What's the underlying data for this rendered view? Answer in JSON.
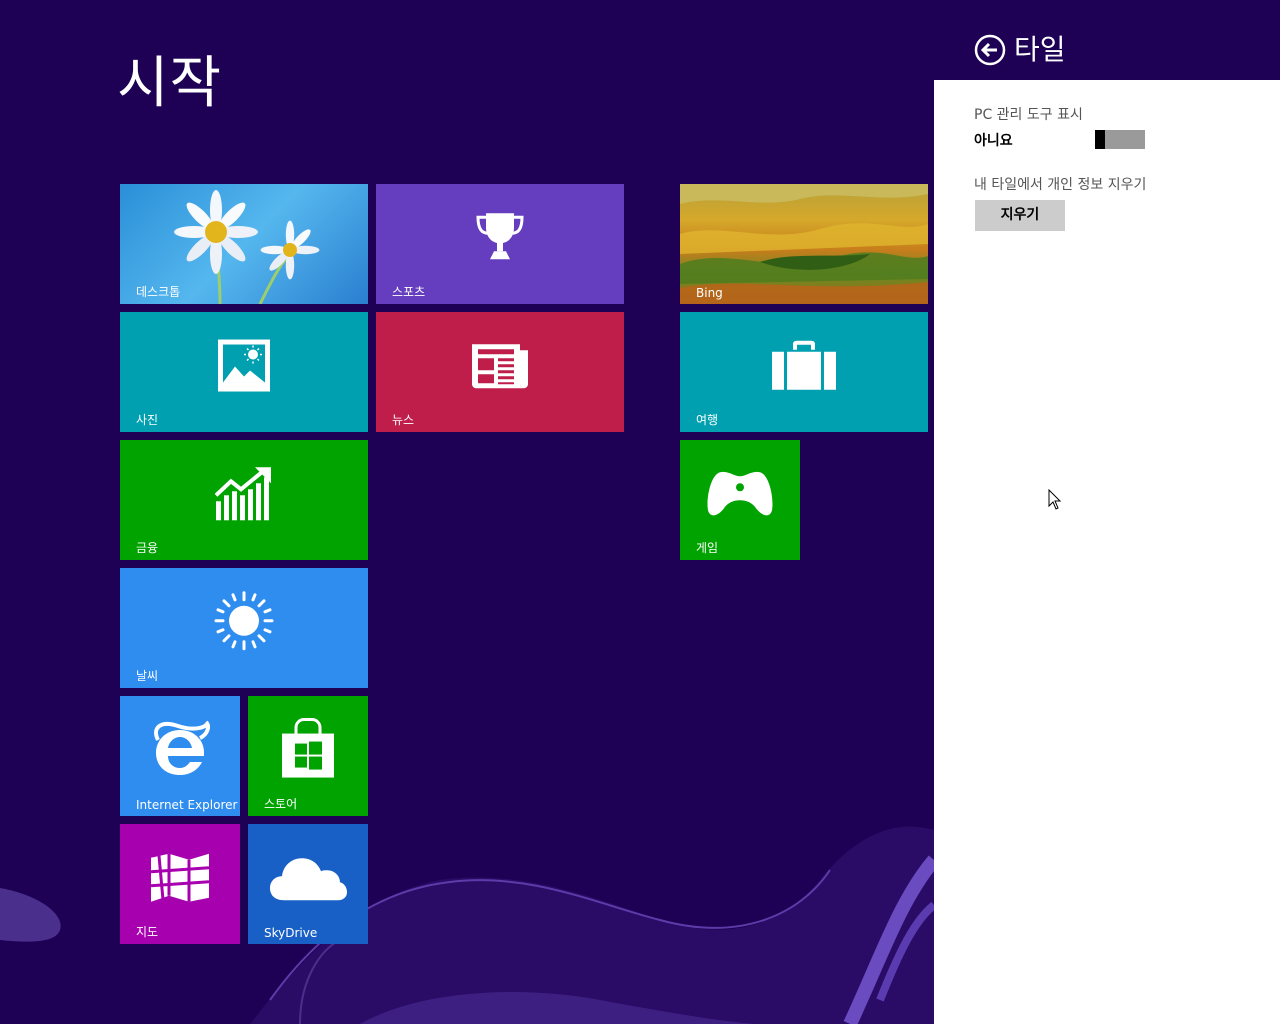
{
  "start": {
    "title": "시작",
    "tiles": {
      "desktop": {
        "label": "데스크톱",
        "icon": "desktop-wallpaper-flowers"
      },
      "sports": {
        "label": "스포츠",
        "icon": "trophy-icon"
      },
      "bing": {
        "label": "Bing",
        "icon": "landscape-photo"
      },
      "photos": {
        "label": "사진",
        "icon": "photo-icon"
      },
      "news": {
        "label": "뉴스",
        "icon": "newspaper-icon"
      },
      "travel": {
        "label": "여행",
        "icon": "suitcase-icon"
      },
      "finance": {
        "label": "금융",
        "icon": "chart-up-icon"
      },
      "games": {
        "label": "게임",
        "icon": "gamepad-icon"
      },
      "weather": {
        "label": "날씨",
        "icon": "sun-icon"
      },
      "ie": {
        "label": "Internet Explorer",
        "icon": "internet-explorer-icon"
      },
      "store": {
        "label": "스토어",
        "icon": "store-bag-icon"
      },
      "maps": {
        "label": "지도",
        "icon": "map-icon"
      },
      "skydrive": {
        "label": "SkyDrive",
        "icon": "cloud-icon"
      }
    }
  },
  "panel": {
    "title": "타일",
    "pc_tools_label": "PC 관리 도구 표시",
    "pc_tools_value": "아니요",
    "pc_tools_on": false,
    "clear_label": "내 타일에서 개인 정보 지우기",
    "clear_button": "지우기"
  },
  "colors": {
    "background": "#1e0154",
    "teal": "#00a0b1",
    "purple": "#643ebf",
    "red": "#bf1e4b",
    "green": "#00a300",
    "blue": "#2e8def",
    "magenta": "#a700ae",
    "darkblue": "#1960c6"
  }
}
